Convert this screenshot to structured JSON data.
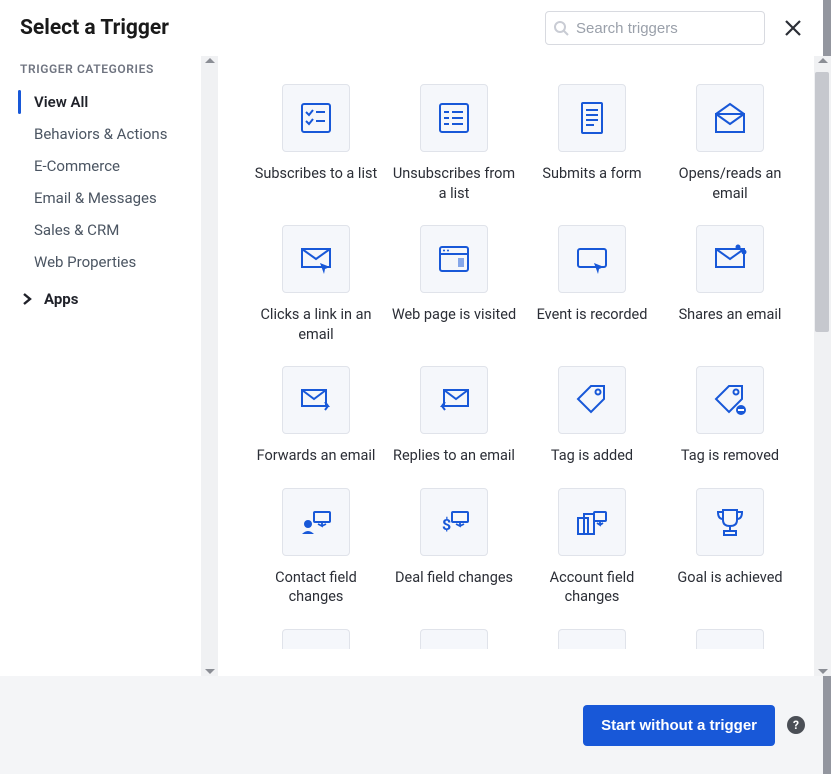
{
  "header": {
    "title": "Select a Trigger",
    "search_placeholder": "Search triggers"
  },
  "sidebar": {
    "heading": "TRIGGER CATEGORIES",
    "categories": [
      {
        "label": "View All",
        "active": true
      },
      {
        "label": "Behaviors & Actions",
        "active": false
      },
      {
        "label": "E-Commerce",
        "active": false
      },
      {
        "label": "Email & Messages",
        "active": false
      },
      {
        "label": "Sales & CRM",
        "active": false
      },
      {
        "label": "Web Properties",
        "active": false
      }
    ],
    "apps_label": "Apps"
  },
  "triggers": [
    {
      "label": "Subscribes to a list",
      "icon": "checklist"
    },
    {
      "label": "Unsubscribes from a list",
      "icon": "checklist-dash"
    },
    {
      "label": "Submits a form",
      "icon": "document"
    },
    {
      "label": "Opens/reads an email",
      "icon": "envelope-open"
    },
    {
      "label": "Clicks a link in an email",
      "icon": "envelope-cursor"
    },
    {
      "label": "Web page is visited",
      "icon": "browser"
    },
    {
      "label": "Event is recorded",
      "icon": "record-play"
    },
    {
      "label": "Shares an email",
      "icon": "envelope-share"
    },
    {
      "label": "Forwards an email",
      "icon": "envelope-forward"
    },
    {
      "label": "Replies to an email",
      "icon": "envelope-reply"
    },
    {
      "label": "Tag is added",
      "icon": "tag"
    },
    {
      "label": "Tag is removed",
      "icon": "tag-remove"
    },
    {
      "label": "Contact field changes",
      "icon": "contact-field"
    },
    {
      "label": "Deal field changes",
      "icon": "deal-field"
    },
    {
      "label": "Account field changes",
      "icon": "account-field"
    },
    {
      "label": "Goal is achieved",
      "icon": "trophy"
    }
  ],
  "footer": {
    "button_label": "Start without a trigger"
  },
  "colors": {
    "primary": "#1858d8"
  }
}
